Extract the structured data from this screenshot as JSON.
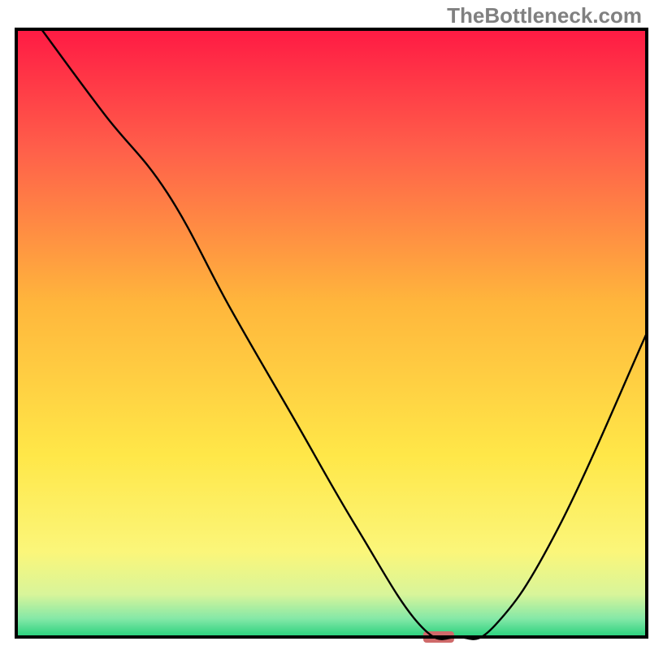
{
  "watermark": "TheBottleneck.com",
  "chart_data": {
    "type": "line",
    "title": "",
    "xlabel": "",
    "ylabel": "",
    "xlim": [
      0,
      100
    ],
    "ylim": [
      0,
      100
    ],
    "x": [
      4,
      14,
      24,
      34,
      44,
      54,
      64,
      70,
      76,
      86,
      100
    ],
    "values": [
      100,
      86,
      73,
      54,
      36,
      18,
      2,
      0,
      2,
      18,
      50
    ],
    "marker": {
      "x": 67,
      "y": 0,
      "color": "#cf6a6a",
      "rx": 4
    },
    "gradient_stops": [
      {
        "offset": 0.0,
        "color": "#ff1a44"
      },
      {
        "offset": 0.2,
        "color": "#ff604a"
      },
      {
        "offset": 0.45,
        "color": "#ffb63c"
      },
      {
        "offset": 0.7,
        "color": "#ffe748"
      },
      {
        "offset": 0.86,
        "color": "#fbf67a"
      },
      {
        "offset": 0.93,
        "color": "#d8f59a"
      },
      {
        "offset": 0.97,
        "color": "#84e8a7"
      },
      {
        "offset": 1.0,
        "color": "#26d07c"
      }
    ]
  }
}
